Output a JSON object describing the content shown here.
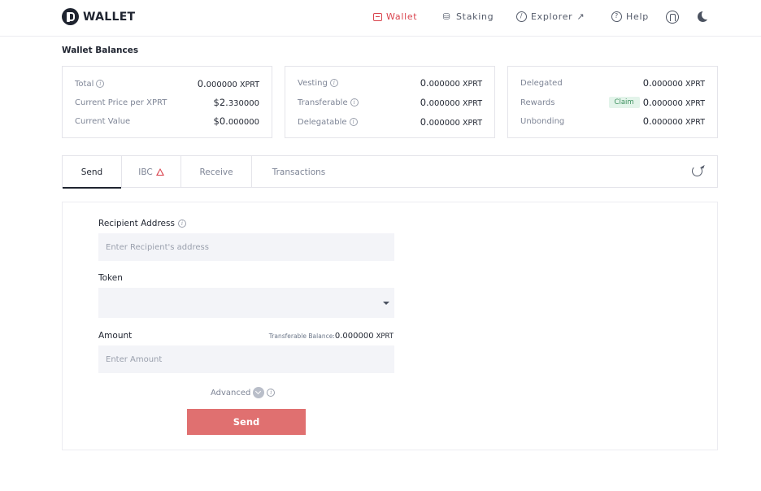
{
  "app": {
    "title": "WALLET"
  },
  "nav": {
    "wallet": "Wallet",
    "staking": "Staking",
    "explorer": "Explorer",
    "explorer_ext": "↗",
    "help": "Help"
  },
  "colors": {
    "accent": "#d9434d",
    "send_button": "#e07070",
    "claim_bg": "#e3f4ea",
    "claim_text": "#3b8f5c"
  },
  "balances": {
    "title": "Wallet Balances",
    "total_label": "Total",
    "total_big": "0.",
    "total_small": "000000",
    "total_unit": "XPRT",
    "price_label": "Current Price per XPRT",
    "price_big": "$2.",
    "price_small": "330000",
    "value_label": "Current Value",
    "value_big": "$0.",
    "value_small": "000000",
    "vesting_label": "Vesting",
    "vesting_big": "0.",
    "vesting_small": "000000",
    "vesting_unit": "XPRT",
    "transferable_label": "Transferable",
    "transferable_big": "0.",
    "transferable_small": "000000",
    "transferable_unit": "XPRT",
    "delegatable_label": "Delegatable",
    "delegatable_big": "0.",
    "delegatable_small": "000000",
    "delegatable_unit": "XPRT",
    "delegated_label": "Delegated",
    "delegated_big": "0.",
    "delegated_small": "000000",
    "delegated_unit": "XPRT",
    "rewards_label": "Rewards",
    "claim_label": "Claim",
    "rewards_big": "0.",
    "rewards_small": "000000",
    "rewards_unit": "XPRT",
    "unbonding_label": "Unbonding",
    "unbonding_big": "0.",
    "unbonding_small": "000000",
    "unbonding_unit": "XPRT"
  },
  "tabs": {
    "send": "Send",
    "ibc": "IBC",
    "receive": "Receive",
    "transactions": "Transactions"
  },
  "form": {
    "recipient_label": "Recipient Address",
    "recipient_placeholder": "Enter Recipient's address",
    "token_label": "Token",
    "amount_label": "Amount",
    "transferable_balance_label": "Transferable Balance:",
    "transferable_balance_value": "0.000000",
    "transferable_balance_unit": "XPRT",
    "amount_placeholder": "Enter Amount",
    "advanced_label": "Advanced",
    "send_label": "Send"
  }
}
